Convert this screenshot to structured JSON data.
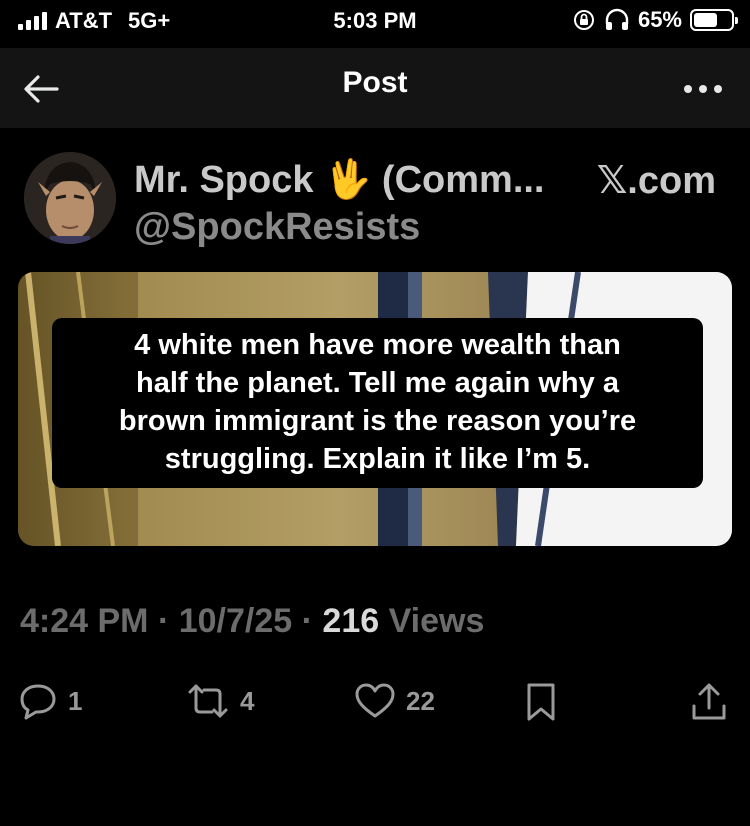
{
  "status_bar": {
    "carrier": "AT&T",
    "network": "5G+",
    "time": "5:03 PM",
    "battery": "65%",
    "battery_level": 0.65
  },
  "header": {
    "title": "Post"
  },
  "post": {
    "display_name": "Mr. Spock 🖖 (Comm...",
    "source": "𝕏.com",
    "handle": "@SpockResists",
    "caption_lines": [
      "4 white men have more wealth than",
      "half the planet. Tell me again why a",
      "brown immigrant is the reason you’re",
      "struggling. Explain it like I’m 5."
    ],
    "time": "4:24 PM",
    "date": "10/7/25",
    "separator": "·",
    "views_count": "216",
    "views_label": "Views"
  },
  "actions": {
    "replies": "1",
    "reposts": "4",
    "likes": "22"
  },
  "colors": {
    "background": "#000000",
    "header_bg": "#141414",
    "muted_text": "#6c6c6c",
    "icon": "#9a9a9a"
  }
}
